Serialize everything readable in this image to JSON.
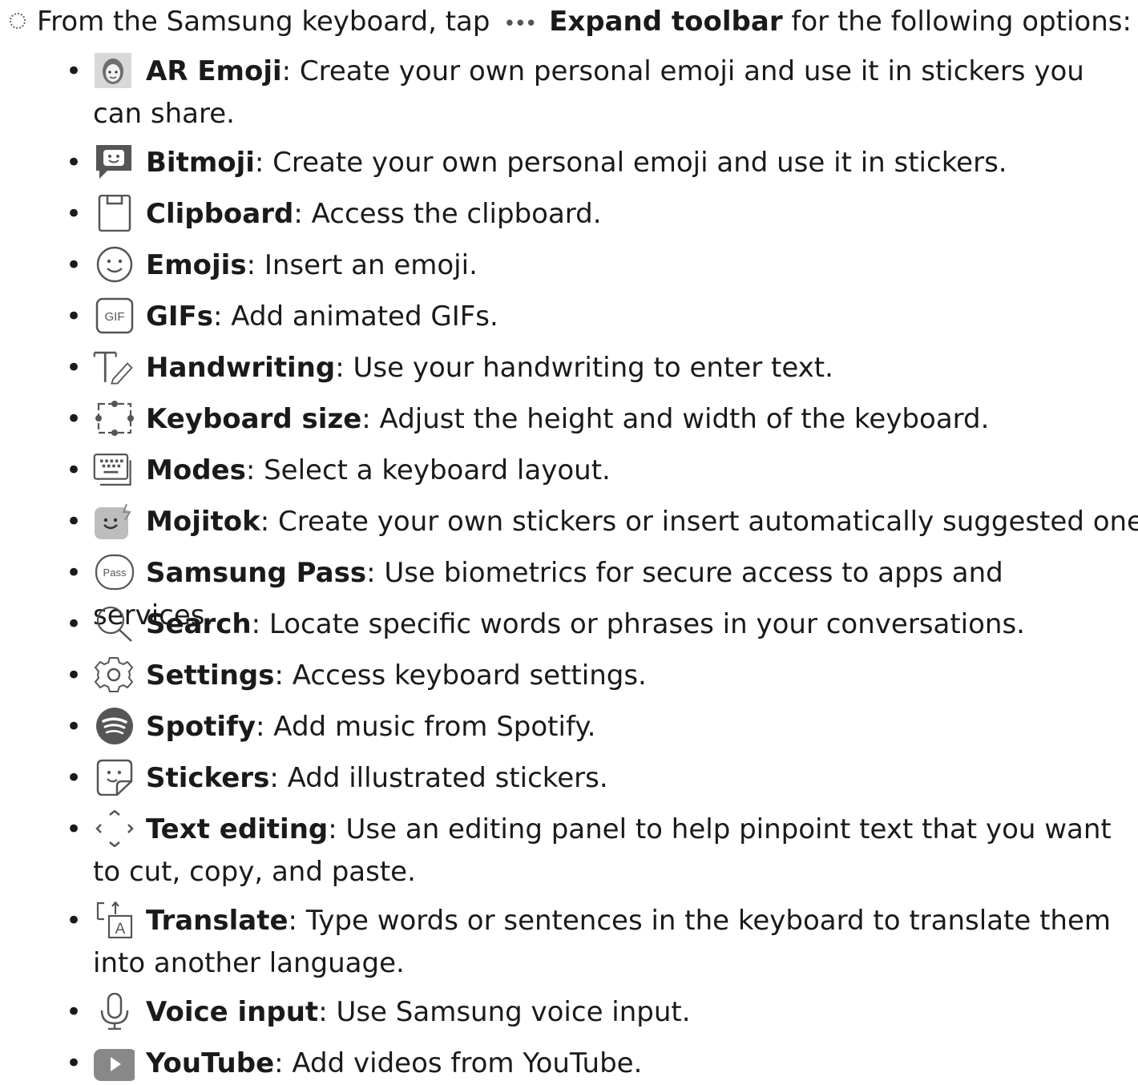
{
  "intro": {
    "prefix": "From the Samsung keyboard, tap",
    "more_glyph": "•••",
    "action": "Expand toolbar",
    "suffix": "for the following options:"
  },
  "bullet_glyph": "•",
  "items": [
    {
      "icon": "ar-emoji-icon",
      "label": "AR Emoji",
      "desc": ": Create your own personal emoji and use it in stickers you can share."
    },
    {
      "icon": "bitmoji-icon",
      "label": "Bitmoji",
      "desc": ": Create your own personal emoji and use it in stickers."
    },
    {
      "icon": "clipboard-icon",
      "label": "Clipboard",
      "desc": ": Access the clipboard."
    },
    {
      "icon": "emoji-smiley-icon",
      "label": "Emojis",
      "desc": ": Insert an emoji."
    },
    {
      "icon": "gif-icon",
      "label": "GIFs",
      "desc": ": Add animated GIFs."
    },
    {
      "icon": "handwriting-icon",
      "label": "Handwriting",
      "desc": ": Use your handwriting to enter text."
    },
    {
      "icon": "keyboard-size-icon",
      "label": "Keyboard size",
      "desc": ": Adjust the height and width of the keyboard."
    },
    {
      "icon": "keyboard-modes-icon",
      "label": "Modes",
      "desc": ": Select a keyboard layout."
    },
    {
      "icon": "mojitok-icon",
      "label": "Mojitok",
      "desc": ": Create your own stickers or insert automatically suggested ones."
    },
    {
      "icon": "samsung-pass-icon",
      "label": "Samsung Pass",
      "desc": ": Use biometrics for secure access to apps and services."
    },
    {
      "icon": "search-icon",
      "label": "Search",
      "desc": ": Locate specific words or phrases in your conversations."
    },
    {
      "icon": "gear-icon",
      "label": "Settings",
      "desc": ": Access keyboard settings."
    },
    {
      "icon": "spotify-icon",
      "label": "Spotify",
      "desc": ": Add music from Spotify."
    },
    {
      "icon": "stickers-icon",
      "label": "Stickers",
      "desc": ": Add illustrated stickers."
    },
    {
      "icon": "text-editing-icon",
      "label": "Text editing",
      "desc": ": Use an editing panel to help pinpoint text that you want to cut, copy, and paste."
    },
    {
      "icon": "translate-icon",
      "label": "Translate",
      "desc": ": Type words or sentences in the keyboard to translate them into another language."
    },
    {
      "icon": "microphone-icon",
      "label": "Voice input",
      "desc": ": Use Samsung voice input."
    },
    {
      "icon": "youtube-icon",
      "label": "YouTube",
      "desc": ": Add videos from YouTube."
    }
  ],
  "icon_text": {
    "gif": "GIF",
    "pass": "Pass",
    "translate": "A"
  }
}
